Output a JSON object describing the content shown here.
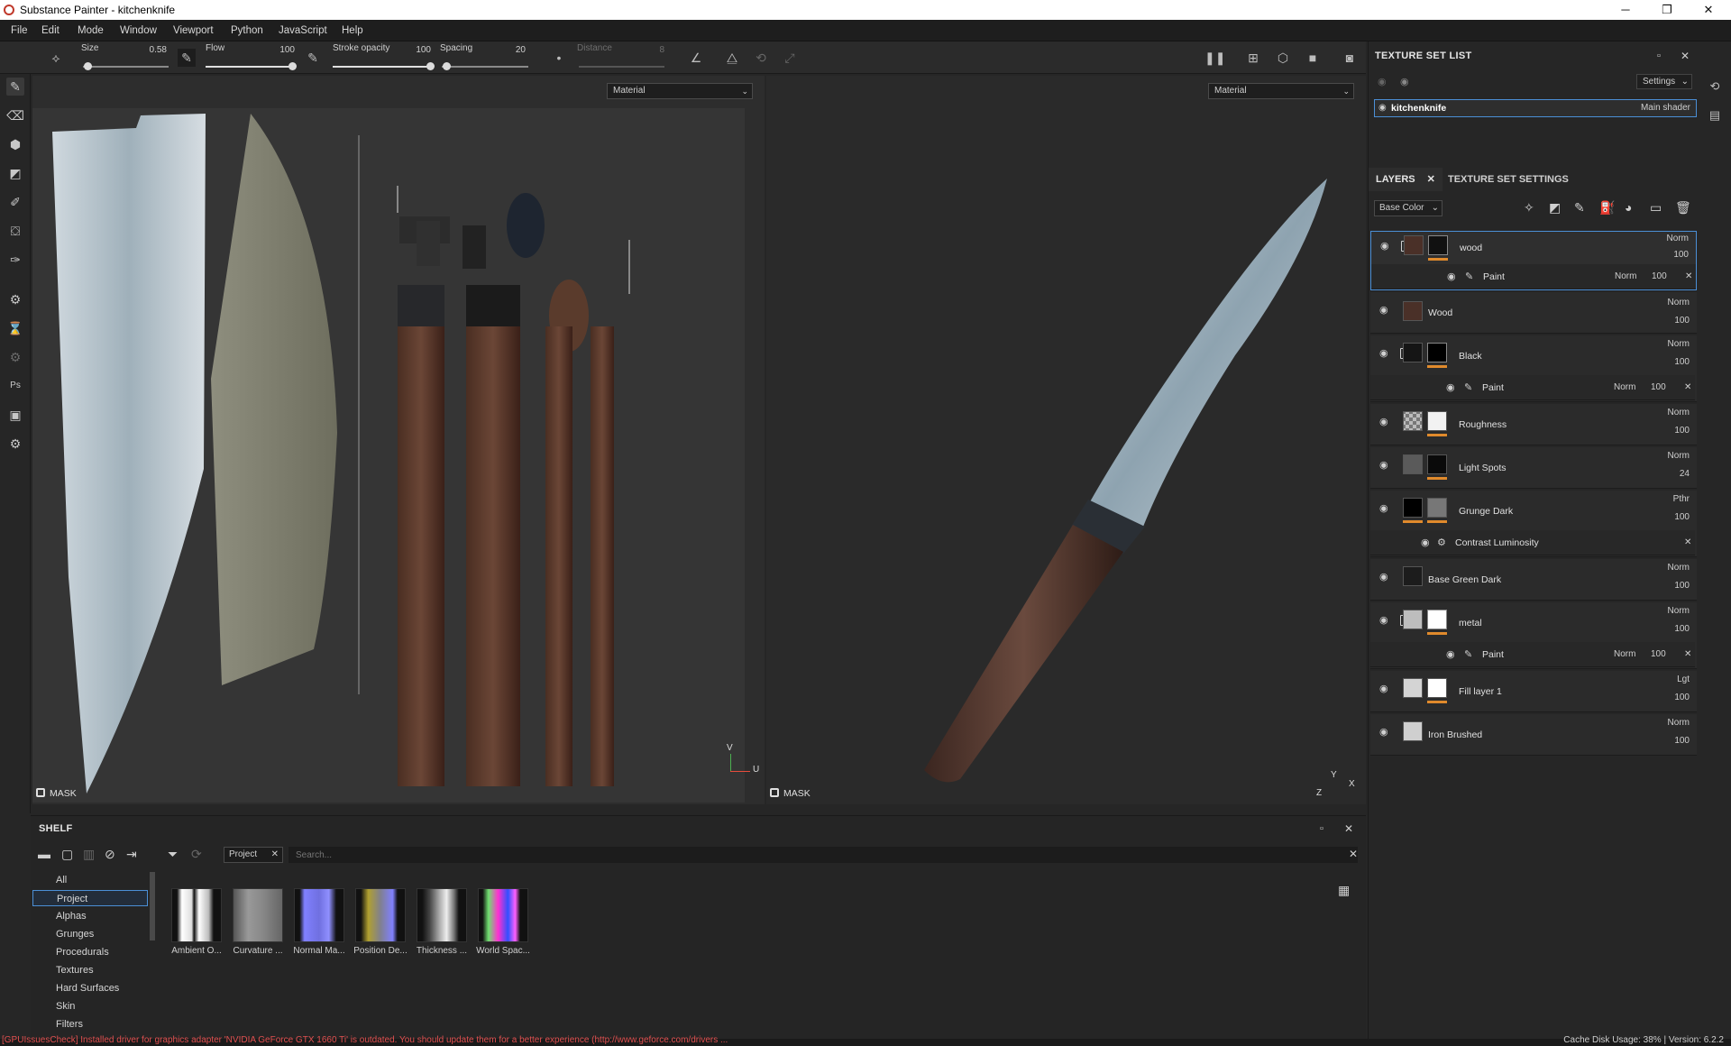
{
  "window": {
    "title": "Substance Painter - kitchenknife",
    "controls": {
      "minimize": "─",
      "maximize": "❐",
      "close": "✕"
    }
  },
  "menu": [
    "File",
    "Edit",
    "Mode",
    "Window",
    "Viewport",
    "Python",
    "JavaScript",
    "Help"
  ],
  "toolbar": {
    "size_label": "Size",
    "size_value": "0.58",
    "size_level": 0.05,
    "flow_label": "Flow",
    "flow_value": "100",
    "flow_level": 1.0,
    "stroke_opacity_label": "Stroke opacity",
    "stroke_opacity_value": "100",
    "stroke_opacity_level": 1.0,
    "spacing_label": "Spacing",
    "spacing_value": "20",
    "spacing_level": 0.05,
    "distance_label": "Distance",
    "distance_value": "8"
  },
  "viewport_2d": {
    "mode": "Material",
    "mask_label": "MASK",
    "axis_v": "V",
    "axis_u": "U"
  },
  "viewport_3d": {
    "mode": "Material",
    "mask_label": "MASK",
    "axis_x": "X",
    "axis_y": "Y",
    "axis_z": "Z"
  },
  "texture_set_list": {
    "title": "TEXTURE SET LIST",
    "settings_label": "Settings",
    "item_name": "kitchenknife",
    "item_shader": "Main shader"
  },
  "layers_panel": {
    "tab_layers": "LAYERS",
    "tab_texture_set_settings": "TEXTURE SET SETTINGS",
    "channel": "Base Color",
    "layers": [
      {
        "name": "wood",
        "blend": "Norm",
        "opacity": "100",
        "type": "folder",
        "selected": true,
        "sub": {
          "name": "Paint",
          "blend": "Norm",
          "opacity": "100"
        }
      },
      {
        "name": "Wood",
        "blend": "Norm",
        "opacity": "100",
        "type": "fill"
      },
      {
        "name": "Black",
        "blend": "Norm",
        "opacity": "100",
        "type": "folder",
        "sub": {
          "name": "Paint",
          "blend": "Norm",
          "opacity": "100"
        }
      },
      {
        "name": "Roughness",
        "blend": "Norm",
        "opacity": "100",
        "type": "fill"
      },
      {
        "name": "Light Spots",
        "blend": "Norm",
        "opacity": "24",
        "type": "fill"
      },
      {
        "name": "Grunge Dark",
        "blend": "Pthr",
        "opacity": "100",
        "type": "fill",
        "sub": {
          "name": "Contrast Luminosity"
        }
      },
      {
        "name": "Base Green Dark",
        "blend": "Norm",
        "opacity": "100",
        "type": "fill"
      },
      {
        "name": "metal",
        "blend": "Norm",
        "opacity": "100",
        "type": "folder",
        "sub": {
          "name": "Paint",
          "blend": "Norm",
          "opacity": "100"
        }
      },
      {
        "name": "Fill layer 1",
        "blend": "Lgt",
        "opacity": "100",
        "type": "fill"
      },
      {
        "name": "Iron Brushed",
        "blend": "Norm",
        "opacity": "100",
        "type": "fill"
      }
    ]
  },
  "shelf": {
    "title": "SHELF",
    "filter_tag": "Project",
    "search_placeholder": "Search...",
    "categories": [
      "All",
      "Project",
      "Alphas",
      "Grunges",
      "Procedurals",
      "Textures",
      "Hard Surfaces",
      "Skin",
      "Filters"
    ],
    "assets": [
      "Ambient O...",
      "Curvature ...",
      "Normal Ma...",
      "Position De...",
      "Thickness ...",
      "World Spac..."
    ]
  },
  "status": {
    "error": "[GPUIssuesCheck] Installed driver for graphics adapter 'NVIDIA GeForce GTX 1660 Ti' is outdated. You should update them for a better experience (http://www.geforce.com/drivers ...",
    "cache": "Cache Disk Usage:    38%  |  Version: 6.2.2"
  },
  "colors": {
    "accent": "#4b8fd6",
    "orange": "#e08a2c",
    "error": "#e05050"
  }
}
